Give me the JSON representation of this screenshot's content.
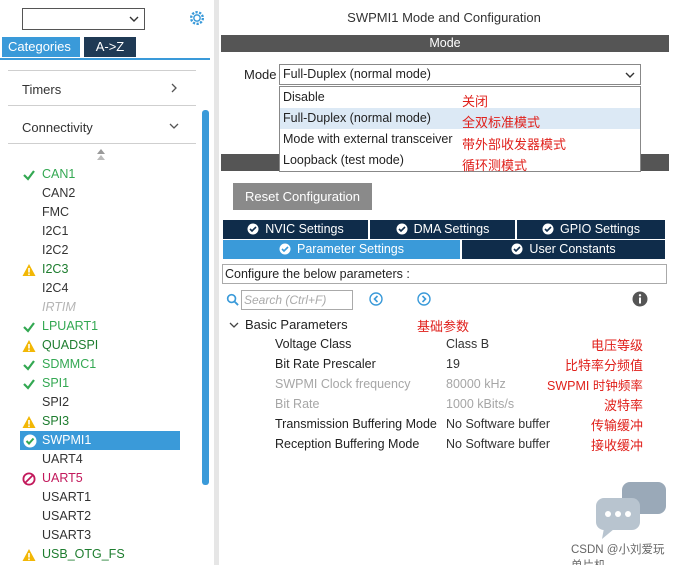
{
  "left": {
    "tabs": {
      "categories": "Categories",
      "az": "A->Z"
    },
    "sections": [
      {
        "label": "Timers",
        "arrow": ">"
      },
      {
        "label": "Connectivity",
        "arrow": "v"
      }
    ],
    "peripherals": [
      {
        "label": "CAN1",
        "status": "ok"
      },
      {
        "label": "CAN2",
        "status": "plain"
      },
      {
        "label": "FMC",
        "status": "plain"
      },
      {
        "label": "I2C1",
        "status": "plain"
      },
      {
        "label": "I2C2",
        "status": "plain"
      },
      {
        "label": "I2C3",
        "status": "warn"
      },
      {
        "label": "I2C4",
        "status": "plain"
      },
      {
        "label": "IRTIM",
        "status": "dis"
      },
      {
        "label": "LPUART1",
        "status": "ok"
      },
      {
        "label": "QUADSPI",
        "status": "warn"
      },
      {
        "label": "SDMMC1",
        "status": "ok"
      },
      {
        "label": "SPI1",
        "status": "ok"
      },
      {
        "label": "SPI2",
        "status": "plain"
      },
      {
        "label": "SPI3",
        "status": "warn"
      },
      {
        "label": "SWPMI1",
        "status": "sel"
      },
      {
        "label": "UART4",
        "status": "plain"
      },
      {
        "label": "UART5",
        "status": "err"
      },
      {
        "label": "USART1",
        "status": "plain"
      },
      {
        "label": "USART2",
        "status": "plain"
      },
      {
        "label": "USART3",
        "status": "plain"
      },
      {
        "label": "USB_OTG_FS",
        "status": "warn"
      }
    ]
  },
  "right": {
    "title": "SWPMI1 Mode and Configuration",
    "mode_header": "Mode",
    "mode_label": "Mode",
    "mode_value": "Full-Duplex (normal mode)",
    "options": [
      {
        "label": "Disable",
        "note": "关闭"
      },
      {
        "label": "Full-Duplex (normal mode)",
        "note": "全双标准模式"
      },
      {
        "label": "Mode with external transceiver",
        "note": "带外部收发器模式"
      },
      {
        "label": "Loopback (test mode)",
        "note": "循环测模式"
      }
    ],
    "reset_label": "Reset Configuration",
    "tabs": [
      {
        "label": "NVIC Settings"
      },
      {
        "label": "DMA Settings"
      },
      {
        "label": "GPIO Settings"
      },
      {
        "label": "Parameter Settings"
      },
      {
        "label": "User Constants"
      }
    ],
    "config_hint": "Configure the below parameters :",
    "search_placeholder": "Search (Ctrl+F)",
    "group": {
      "label": "Basic Parameters",
      "note": "基础参数"
    },
    "params": [
      {
        "name": "Voltage Class",
        "value": "Class B",
        "note": "电压等级"
      },
      {
        "name": "Bit Rate Prescaler",
        "value": "19",
        "note": "比特率分频值"
      },
      {
        "name": "SWPMI Clock frequency",
        "value": "80000 kHz",
        "note": "SWPMI 时钟频率"
      },
      {
        "name": "Bit Rate",
        "value": "1000 kBits/s",
        "note": "波特率"
      },
      {
        "name": "Transmission Buffering Mode",
        "value": "No Software buffer",
        "note": "传输缓冲"
      },
      {
        "name": "Reception Buffering Mode",
        "value": "No Software buffer",
        "note": "接收缓冲"
      }
    ]
  },
  "watermark": "CSDN @小刘爱玩单片机",
  "colors": {
    "accent": "#3a9ad9",
    "navy": "#0f2c4a",
    "ok": "#33a852",
    "warn": "#f2b705",
    "err": "#c2185b",
    "annotation": "#e0201b"
  }
}
